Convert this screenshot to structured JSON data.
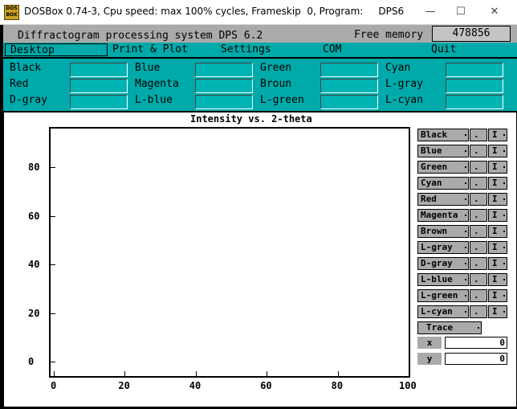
{
  "window": {
    "title": "DOSBox 0.74-3, Cpu speed: max 100% cycles, Frameskip  0, Program:     DPS6",
    "app_icon_text": "DOS BOX",
    "minimize": "—",
    "maximize": "☐",
    "close": "✕"
  },
  "header": {
    "program": "Diffractogram processing system DPS 6.2",
    "free_memory_label": "Free memory",
    "free_memory_value": "478856"
  },
  "menu": {
    "items": [
      "Desktop",
      "Print & Plot",
      "Settings",
      "COM",
      "Quit"
    ],
    "active": "Desktop"
  },
  "palette": {
    "colors": [
      "Black",
      "Blue",
      "Green",
      "Cyan",
      "Red",
      "Magenta",
      "Broun",
      "L-gray",
      "D-gray",
      "L-blue",
      "L-green",
      "L-cyan"
    ]
  },
  "plot": {
    "title": "Intensity vs. 2-theta",
    "y_ticks": [
      "80",
      "60",
      "40",
      "20",
      "0"
    ],
    "x_ticks": [
      "0",
      "20",
      "40",
      "60",
      "80",
      "100"
    ]
  },
  "chart_data": {
    "type": "line",
    "title": "Intensity vs. 2-theta",
    "xlabel": "",
    "ylabel": "",
    "xlim": [
      0,
      100
    ],
    "ylim": [
      0,
      90
    ],
    "x_ticks": [
      0,
      20,
      40,
      60,
      80,
      100
    ],
    "y_ticks": [
      0,
      20,
      40,
      60,
      80
    ],
    "series": []
  },
  "legend": {
    "items": [
      "Black",
      "Blue",
      "Green",
      "Cyan",
      "Red",
      "Magenta",
      "Brown",
      "L-gray",
      "D-gray",
      "L-blue",
      "L-green",
      "L-cyan"
    ],
    "dot_label": ".",
    "i_label": "I",
    "trace_label": "Trace"
  },
  "coords": {
    "x_label": "x",
    "x_value": "0",
    "y_label": "y",
    "y_value": "0"
  }
}
